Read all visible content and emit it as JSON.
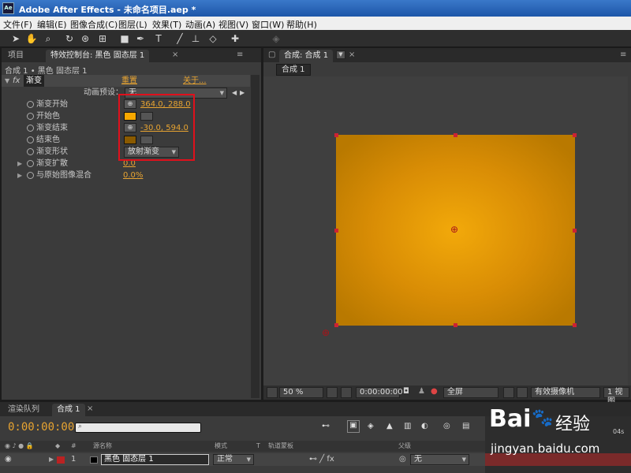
{
  "window": {
    "app_badge": "Ae",
    "title": "Adobe After Effects - 未命名项目.aep *"
  },
  "menu": [
    "文件(F)",
    "编辑(E)",
    "图像合成(C)",
    "图层(L)",
    "效果(T)",
    "动画(A)",
    "视图(V)",
    "窗口(W)",
    "帮助(H)"
  ],
  "left_panel": {
    "tabs": [
      "项目",
      "特效控制台: 黑色 固态层 1"
    ],
    "breadcrumb": "合成 1 • 黑色 固态层 1",
    "effect": {
      "fx": "fx",
      "name": "渐变",
      "reset": "重置",
      "about": "关于...",
      "preset_label": "动画预设：",
      "preset_value": "无"
    },
    "props": [
      {
        "label": "渐变开始",
        "value": "364.0, 288.0"
      },
      {
        "label": "开始色",
        "color": "#f7a800"
      },
      {
        "label": "渐变结束",
        "value": "-30.0, 594.0"
      },
      {
        "label": "结束色",
        "color": "#8a5a00"
      },
      {
        "label": "渐变形状",
        "dropdown": "放射渐变"
      },
      {
        "label": "渐变扩散",
        "value": "0.0"
      },
      {
        "label": "与原始图像混合",
        "value": "0.0%"
      }
    ]
  },
  "right_panel": {
    "tab": "合成: 合成 1",
    "subtab": "合成 1",
    "footer": {
      "zoom": "50 %",
      "timecode": "0:00:00:00",
      "resolution": "全屏",
      "camera": "有效摄像机",
      "views": "1 视图"
    }
  },
  "timeline": {
    "tabs": [
      "渲染队列",
      "合成 1"
    ],
    "timecode": "0:00:00:00",
    "columns": {
      "num": "#",
      "source": "源名称",
      "mode": "模式",
      "t": "T",
      "trkmat": "轨道蒙板",
      "parent": "父级"
    },
    "layer": {
      "num": "1",
      "name": "黑色 固态层 1",
      "mode": "正常",
      "parent": "无"
    },
    "ruler_label": "04s"
  },
  "watermark": {
    "brand": "Bai",
    "suffix": "经验",
    "url": "jingyan.baidu.com"
  },
  "colors": {
    "accent": "#e8a431",
    "highlight": "#e0101c"
  }
}
